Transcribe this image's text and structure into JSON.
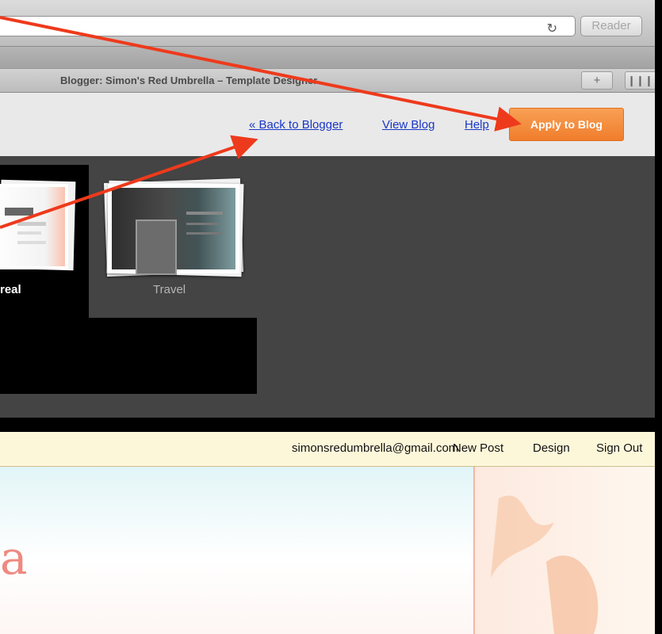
{
  "browser": {
    "reader_label": "Reader",
    "reload_glyph": "↻",
    "tab_title": "Blogger: Simon's Red Umbrella – Template Designer",
    "new_tab_glyph": "+",
    "tab_view_glyph": "❙❙❙"
  },
  "designer": {
    "back_link": "« Back to Blogger",
    "view_blog_link": "View Blog",
    "help_link": "Help",
    "apply_button": "Apply to Blog",
    "templates": [
      {
        "label": "real",
        "selected": true
      },
      {
        "label": "Travel",
        "selected": false
      }
    ],
    "accent_color": "#f48a3a"
  },
  "blog": {
    "navbar": {
      "email": "simonsredumbrella@gmail.com",
      "new_post": "New Post",
      "design": "Design",
      "sign_out": "Sign Out"
    },
    "title_fragment": "a"
  },
  "annotation": {
    "arrow_color": "#ee3a1c"
  }
}
